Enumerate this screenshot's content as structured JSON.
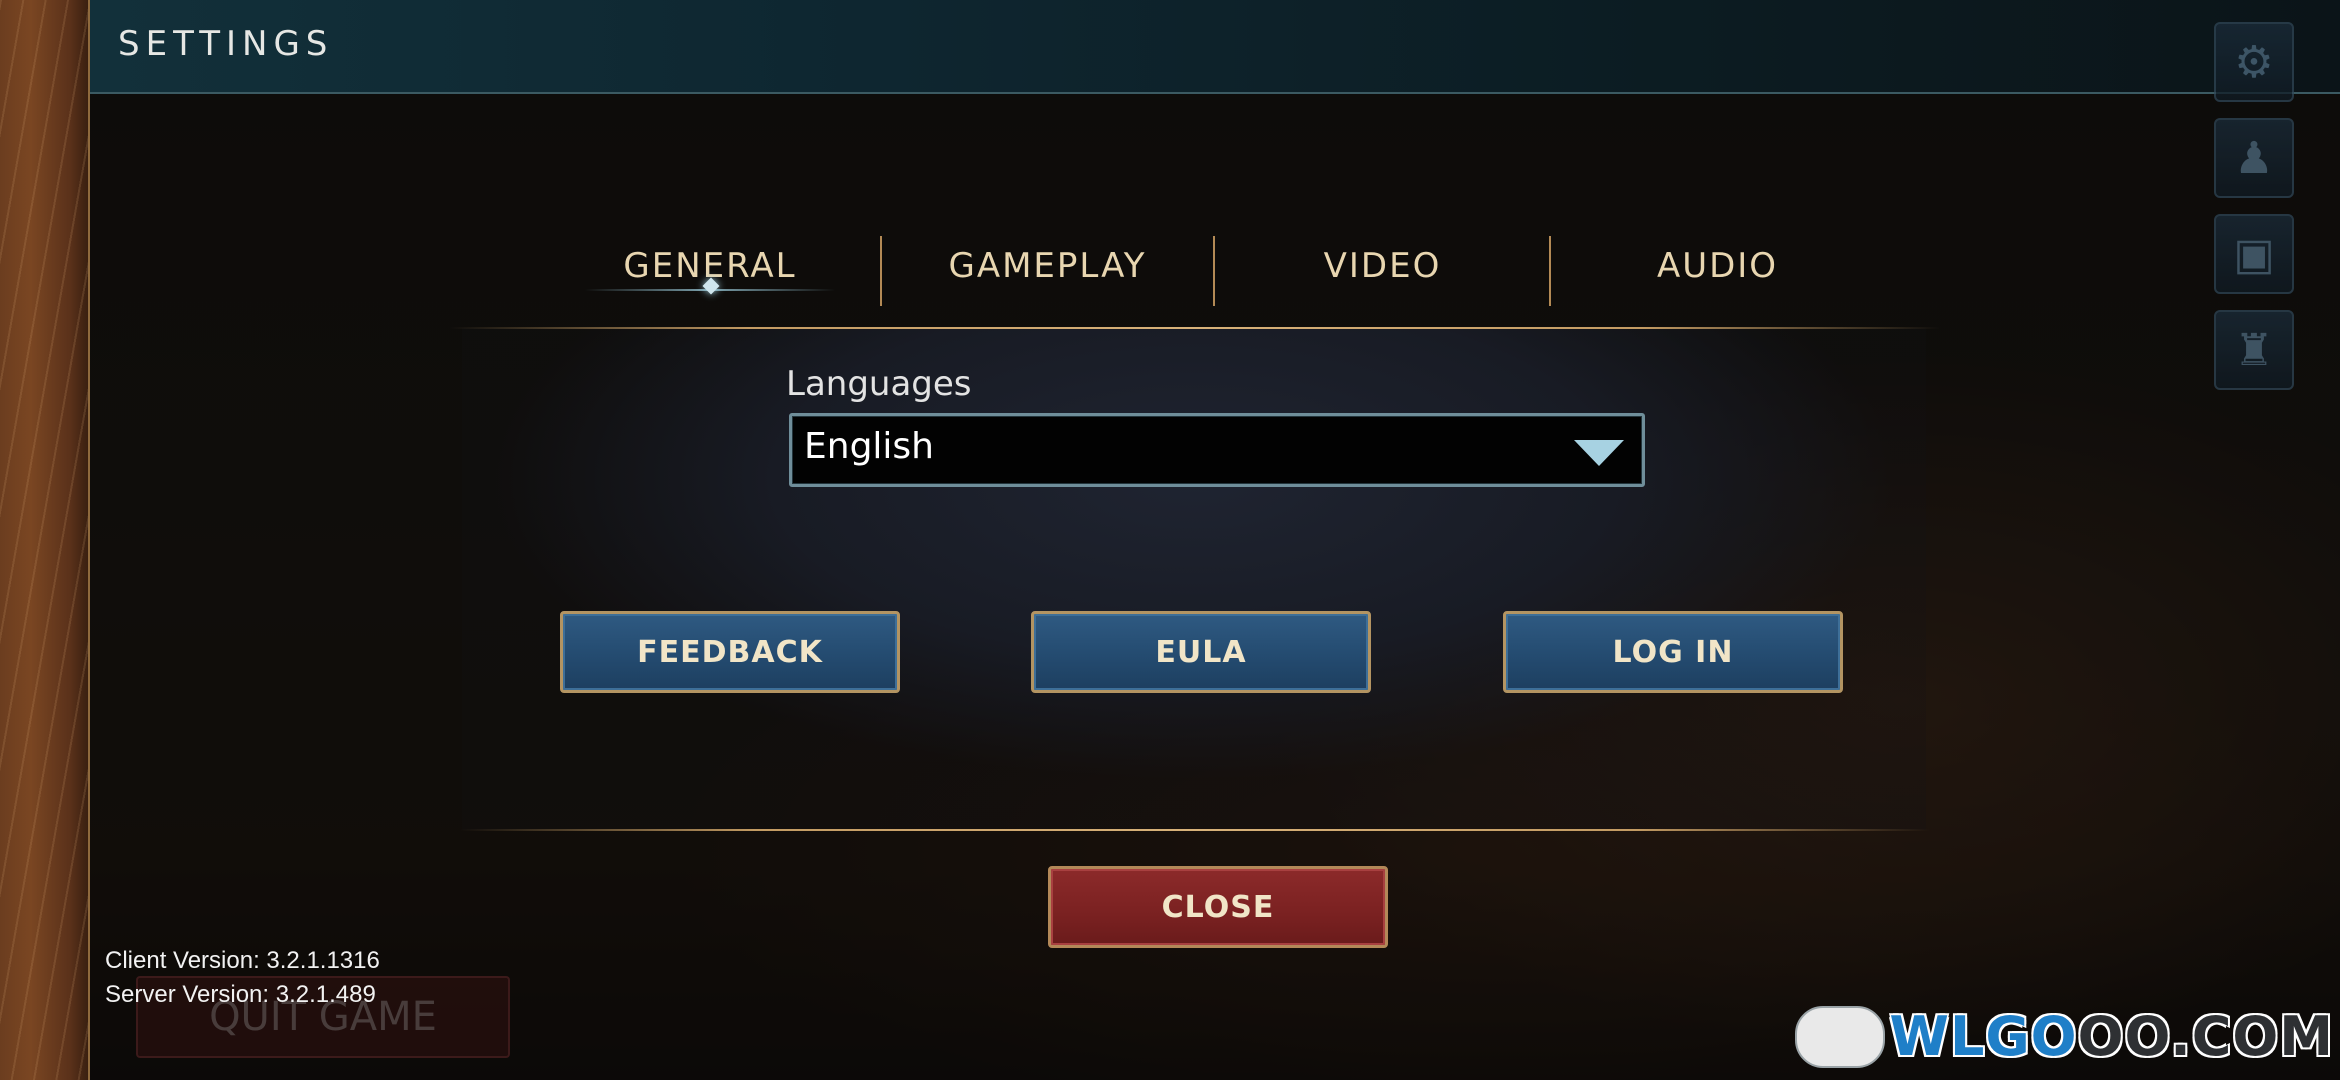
{
  "header": {
    "title": "SETTINGS"
  },
  "side_icons": [
    {
      "name": "gear-icon",
      "glyph": "⚙"
    },
    {
      "name": "group-icon",
      "glyph": "♟"
    },
    {
      "name": "scroll-icon",
      "glyph": "▣"
    },
    {
      "name": "castle-icon",
      "glyph": "♜"
    }
  ],
  "tabs": [
    {
      "label": "GENERAL",
      "active": true
    },
    {
      "label": "GAMEPLAY",
      "active": false
    },
    {
      "label": "VIDEO",
      "active": false
    },
    {
      "label": "AUDIO",
      "active": false
    }
  ],
  "languages": {
    "label": "Languages",
    "selected": "English"
  },
  "buttons": {
    "feedback": "FEEDBACK",
    "eula": "EULA",
    "login": "LOG IN",
    "close": "CLOSE",
    "quit": "QUIT GAME"
  },
  "versions": {
    "client": "Client Version: 3.2.1.1316",
    "server": "Server Version: 3.2.1.489"
  },
  "watermark": {
    "text_blue": "WLGO",
    "text_dark": "OO.COM"
  },
  "colors": {
    "header_bg": "#0e2630",
    "tab_text": "#e8d6b0",
    "button_blue": "#2a5279",
    "button_red": "#7a2121",
    "gold_rule": "#c39b63"
  }
}
